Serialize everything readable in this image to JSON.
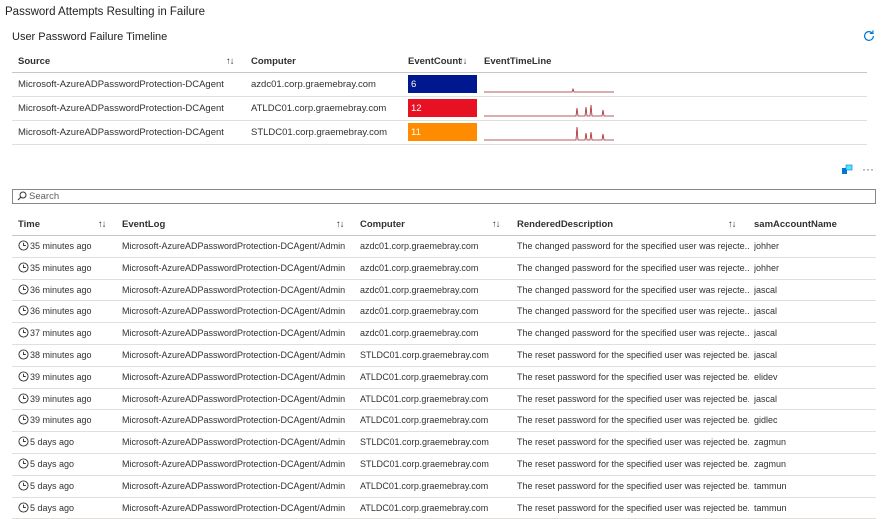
{
  "page_title": "Password Attempts Resulting in Failure",
  "summary": {
    "title": "User Password Failure Timeline",
    "columns": {
      "source": "Source",
      "computer": "Computer",
      "count": "EventCount",
      "timeline": "EventTimeLine"
    },
    "rows": [
      {
        "source": "Microsoft-AzureADPasswordProtection-DCAgent",
        "computer": "azdc01.corp.graemebray.com",
        "count": "6",
        "color": "#00188f"
      },
      {
        "source": "Microsoft-AzureADPasswordProtection-DCAgent",
        "computer": "ATLDC01.corp.graemebray.com",
        "count": "12",
        "color": "#e81123"
      },
      {
        "source": "Microsoft-AzureADPasswordProtection-DCAgent",
        "computer": "STLDC01.corp.graemebray.com",
        "count": "11",
        "color": "#ff8c00"
      }
    ],
    "sparkline_color": "#a4262c"
  },
  "search": {
    "placeholder": "Search"
  },
  "events": {
    "columns": {
      "time": "Time",
      "log": "EventLog",
      "computer": "Computer",
      "desc": "RenderedDescription",
      "account": "samAccountName"
    },
    "rows": [
      {
        "time": "35 minutes ago",
        "log": "Microsoft-AzureADPasswordProtection-DCAgent/Admin",
        "computer": "azdc01.corp.graemebray.com",
        "desc": "The changed password for the specified user was rejecte...",
        "account": "johher"
      },
      {
        "time": "35 minutes ago",
        "log": "Microsoft-AzureADPasswordProtection-DCAgent/Admin",
        "computer": "azdc01.corp.graemebray.com",
        "desc": "The changed password for the specified user was rejecte...",
        "account": "johher"
      },
      {
        "time": "36 minutes ago",
        "log": "Microsoft-AzureADPasswordProtection-DCAgent/Admin",
        "computer": "azdc01.corp.graemebray.com",
        "desc": "The changed password for the specified user was rejecte...",
        "account": "jascal"
      },
      {
        "time": "36 minutes ago",
        "log": "Microsoft-AzureADPasswordProtection-DCAgent/Admin",
        "computer": "azdc01.corp.graemebray.com",
        "desc": "The changed password for the specified user was rejecte...",
        "account": "jascal"
      },
      {
        "time": "37 minutes ago",
        "log": "Microsoft-AzureADPasswordProtection-DCAgent/Admin",
        "computer": "azdc01.corp.graemebray.com",
        "desc": "The changed password for the specified user was rejecte...",
        "account": "jascal"
      },
      {
        "time": "38 minutes ago",
        "log": "Microsoft-AzureADPasswordProtection-DCAgent/Admin",
        "computer": "STLDC01.corp.graemebray.com",
        "desc": "The reset password for the specified user was rejected be...",
        "account": "jascal"
      },
      {
        "time": "39 minutes ago",
        "log": "Microsoft-AzureADPasswordProtection-DCAgent/Admin",
        "computer": "ATLDC01.corp.graemebray.com",
        "desc": "The reset password for the specified user was rejected be...",
        "account": "elidev"
      },
      {
        "time": "39 minutes ago",
        "log": "Microsoft-AzureADPasswordProtection-DCAgent/Admin",
        "computer": "ATLDC01.corp.graemebray.com",
        "desc": "The reset password for the specified user was rejected be...",
        "account": "jascal"
      },
      {
        "time": "39 minutes ago",
        "log": "Microsoft-AzureADPasswordProtection-DCAgent/Admin",
        "computer": "ATLDC01.corp.graemebray.com",
        "desc": "The reset password for the specified user was rejected be...",
        "account": "gidlec"
      },
      {
        "time": "5 days ago",
        "log": "Microsoft-AzureADPasswordProtection-DCAgent/Admin",
        "computer": "STLDC01.corp.graemebray.com",
        "desc": "The reset password for the specified user was rejected be...",
        "account": "zagmun"
      },
      {
        "time": "5 days ago",
        "log": "Microsoft-AzureADPasswordProtection-DCAgent/Admin",
        "computer": "STLDC01.corp.graemebray.com",
        "desc": "The reset password for the specified user was rejected be...",
        "account": "zagmun"
      },
      {
        "time": "5 days ago",
        "log": "Microsoft-AzureADPasswordProtection-DCAgent/Admin",
        "computer": "ATLDC01.corp.graemebray.com",
        "desc": "The reset password for the specified user was rejected be...",
        "account": "tammun"
      },
      {
        "time": "5 days ago",
        "log": "Microsoft-AzureADPasswordProtection-DCAgent/Admin",
        "computer": "ATLDC01.corp.graemebray.com",
        "desc": "The reset password for the specified user was rejected be...",
        "account": "tammun"
      }
    ]
  },
  "icons": {
    "refresh": "refresh-icon",
    "export": "export-icon",
    "more": "more-icon",
    "search": "search-icon",
    "clock": "clock-icon"
  }
}
